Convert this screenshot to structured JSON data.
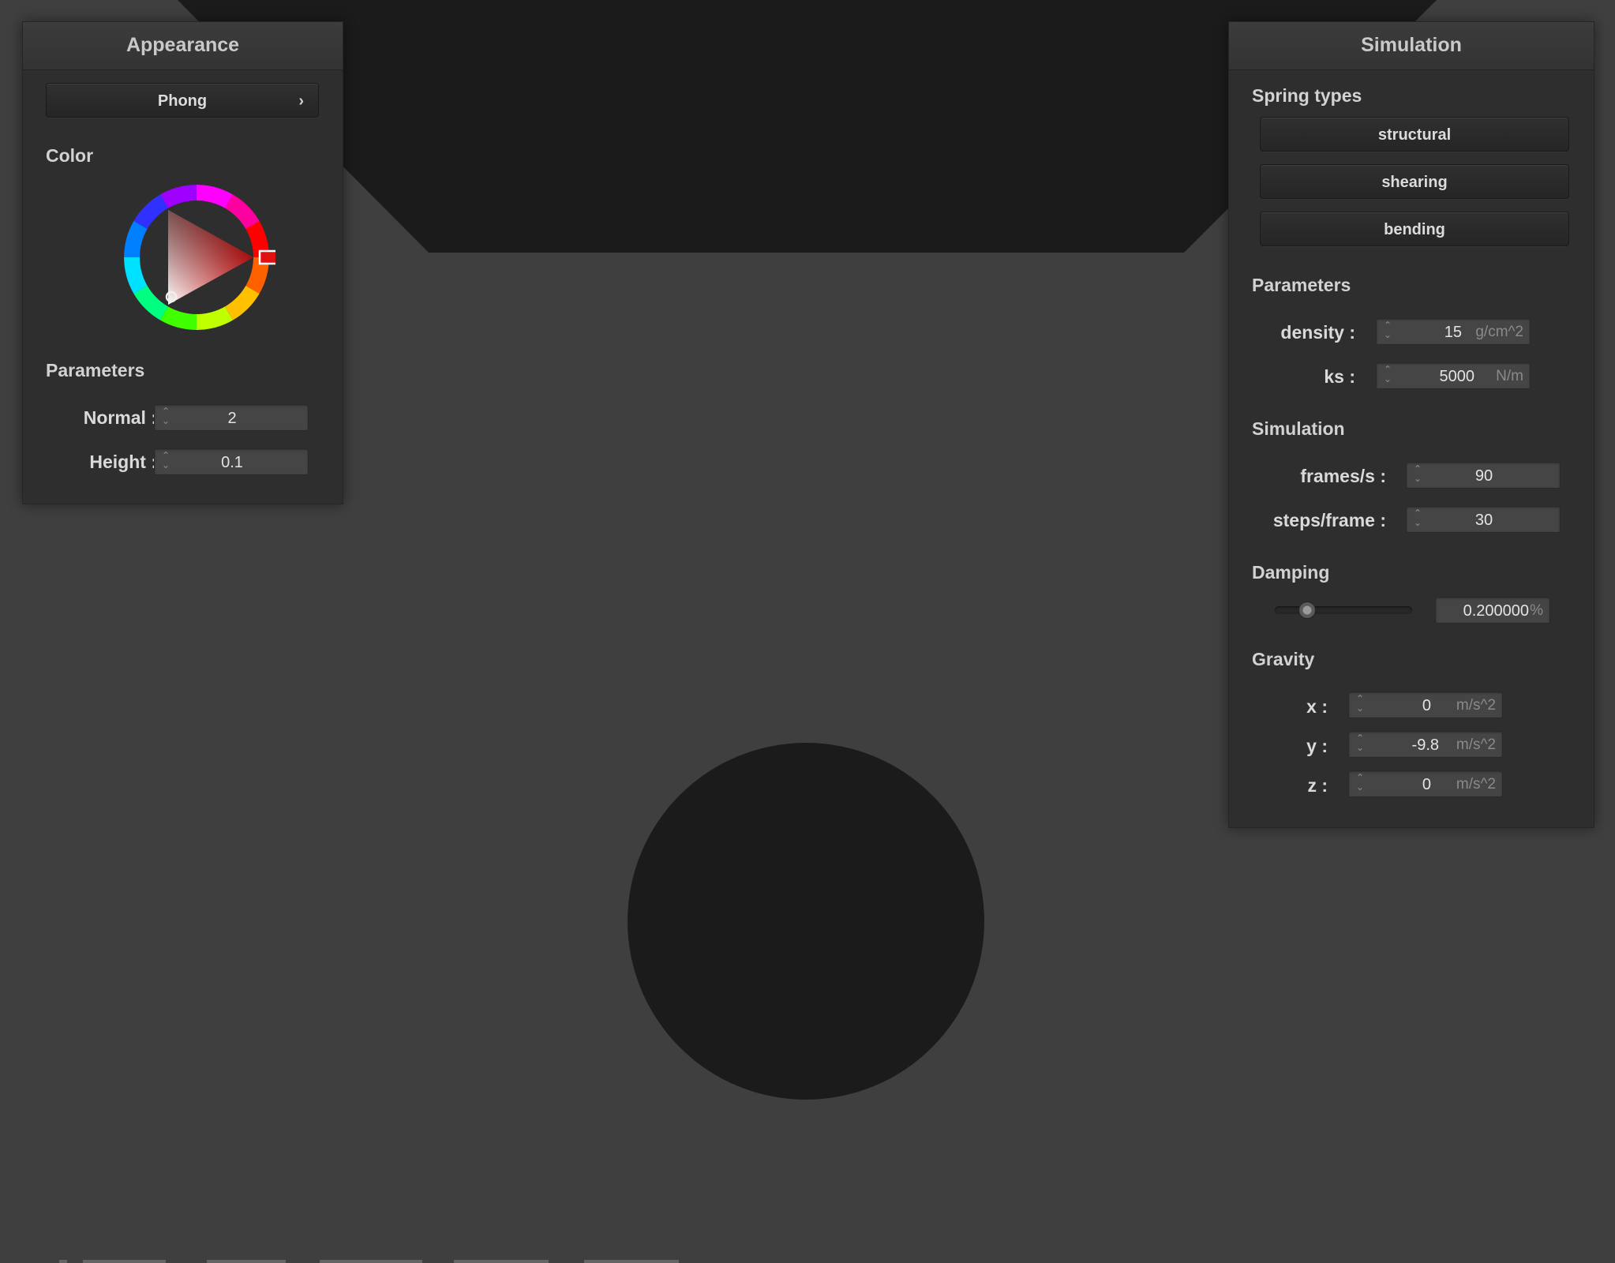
{
  "appearance": {
    "title": "Appearance",
    "shading_button": "Phong",
    "chevron": "›",
    "color_label": "Color",
    "selected_color": "#e01010",
    "parameters_label": "Parameters",
    "normal": {
      "label": "Normal :",
      "value": "2"
    },
    "height": {
      "label": "Height :",
      "value": "0.1"
    }
  },
  "simulation": {
    "title": "Simulation",
    "spring_types_label": "Spring types",
    "spring_types": [
      "structural",
      "shearing",
      "bending"
    ],
    "parameters_label": "Parameters",
    "density": {
      "label": "density :",
      "value": "15",
      "unit": "g/cm^2"
    },
    "ks": {
      "label": "ks :",
      "value": "5000",
      "unit": "N/m"
    },
    "simulation_label": "Simulation",
    "frames_per_s": {
      "label": "frames/s :",
      "value": "90"
    },
    "steps_per_frame": {
      "label": "steps/frame :",
      "value": "30"
    },
    "damping_label": "Damping",
    "damping": {
      "value": "0.200000",
      "unit": "%",
      "slider_fraction": 0.2
    },
    "gravity_label": "Gravity",
    "gravity": [
      {
        "label": "x :",
        "value": "0",
        "unit": "m/s^2"
      },
      {
        "label": "y :",
        "value": "-9.8",
        "unit": "m/s^2"
      },
      {
        "label": "z :",
        "value": "0",
        "unit": "m/s^2"
      }
    ]
  },
  "icons": {
    "spinner": "spinner-icon",
    "chevron": "chevron-right-icon"
  },
  "colors": {
    "background": "#3f3f3f",
    "scene_objects": "#1b1b1b",
    "panel": "#2e2e2e"
  }
}
